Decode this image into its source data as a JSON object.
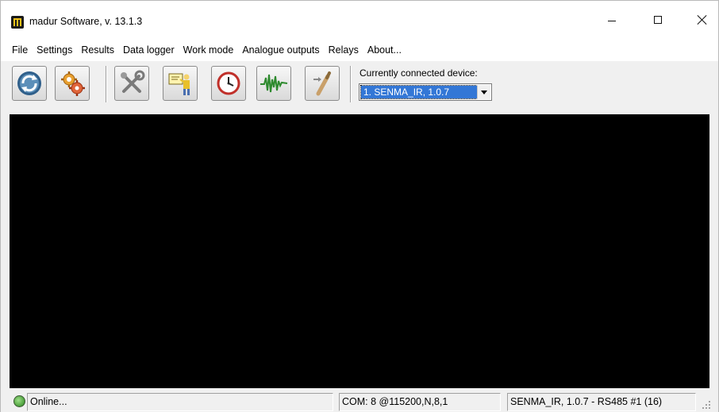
{
  "window": {
    "title": "madur Software, v. 13.1.3"
  },
  "menu": {
    "items": [
      "File",
      "Settings",
      "Results",
      "Data logger",
      "Work mode",
      "Analogue outputs",
      "Relays",
      "About..."
    ]
  },
  "toolbar": {
    "buttons": [
      {
        "icon": "connect-refresh-icon"
      },
      {
        "icon": "gears-icon"
      },
      {
        "icon": "tools-icon"
      },
      {
        "icon": "presentation-icon"
      },
      {
        "icon": "clock-icon"
      },
      {
        "icon": "waveform-icon"
      },
      {
        "icon": "calibration-icon"
      }
    ],
    "device_label": "Currently connected device:",
    "device_selected": "1. SENMA_IR, 1.0.7"
  },
  "status": {
    "online": "Online...",
    "com": "COM: 8 @115200,N,8,1",
    "device": "SENMA_IR, 1.0.7 - RS485 #1 (16)",
    "led_color": "#4a9e3a"
  },
  "colors": {
    "main_background": "#000000",
    "selection": "#3377d6"
  }
}
